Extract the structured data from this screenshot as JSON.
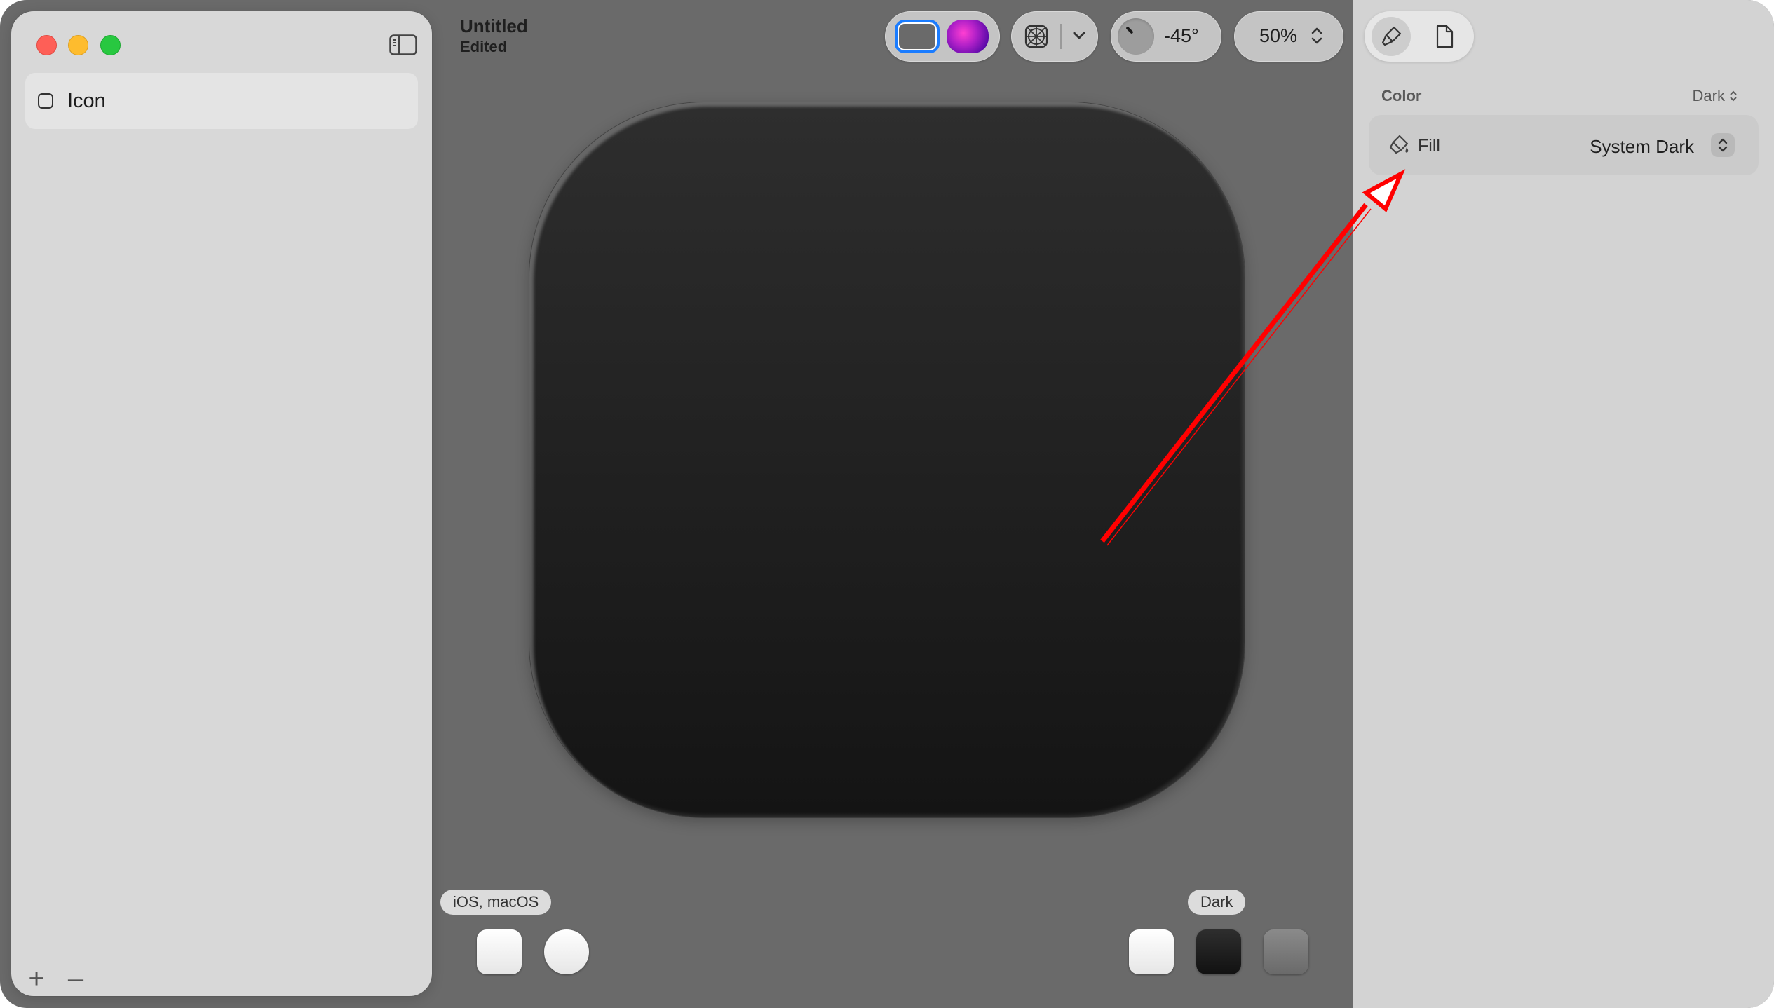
{
  "window": {
    "title": "Untitled",
    "subtitle": "Edited"
  },
  "sidebar": {
    "items": [
      {
        "label": "Icon",
        "icon": "checkbox-icon"
      }
    ],
    "add_label": "+",
    "remove_label": "–"
  },
  "toolbar": {
    "render_mode": {
      "selected": "default",
      "options": [
        "default-icon",
        "liquid-glass-icon"
      ]
    },
    "grid_icon": "grid-overlay-icon",
    "light_angle": "-45°",
    "zoom": "50%"
  },
  "canvas": {
    "platform_badge": "iOS, macOS",
    "appearance_badge": "Dark",
    "platform_shapes": [
      "rounded-square",
      "circle"
    ],
    "appearance_options": [
      "light",
      "dark",
      "tinted"
    ],
    "icon_fill_color": "#1e1e1e"
  },
  "inspector": {
    "tabs": [
      "paintbrush-icon",
      "document-icon"
    ],
    "section_label": "Color",
    "section_mode": "Dark",
    "fill": {
      "label": "Fill",
      "value": "System Dark"
    }
  },
  "annotation": {
    "type": "red-arrow",
    "points_to": "inspector-fill-row",
    "color": "#ff0000"
  }
}
